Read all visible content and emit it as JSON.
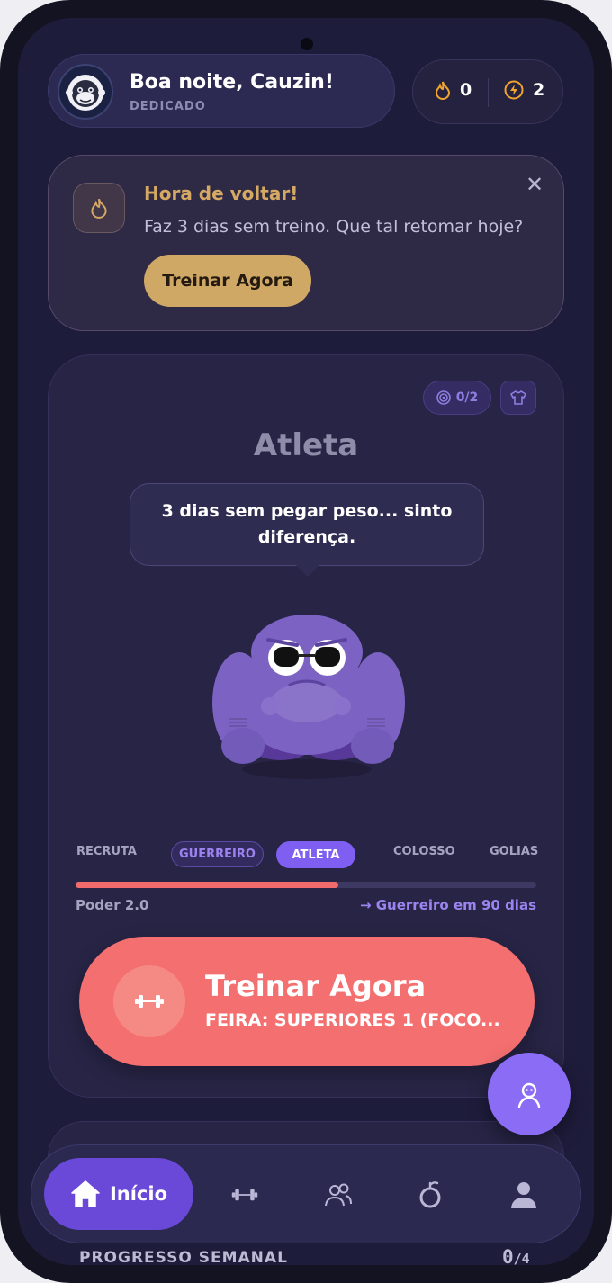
{
  "header": {
    "greeting": "Boa noite, Cauzin!",
    "rank": "DEDICADO",
    "streak_count": "0",
    "energy_count": "2"
  },
  "alert": {
    "title": "Hora de voltar!",
    "message": "Faz 3 dias sem treino. Que tal retomar hoje?",
    "button": "Treinar Agora",
    "close": "✕"
  },
  "character": {
    "goals": "0/2",
    "title": "Atleta",
    "speech": "3 dias sem pegar peso... sinto diferença.",
    "tiers": [
      "RECRUTA",
      "GUERREIRO",
      "ATLETA",
      "COLOSSO",
      "GOLIAS"
    ],
    "current_tier": "ATLETA",
    "progress_fraction": 0.57,
    "power": "Poder 2.0",
    "next_rank": "→ Guerreiro em 90 dias"
  },
  "train": {
    "title": "Treinar Agora",
    "subtitle": "FEIRA: SUPERIORES 1 (FOCO..."
  },
  "nav": {
    "home": "Início",
    "items": [
      "dumbbell-icon",
      "people-icon",
      "nutrition-icon",
      "profile-icon"
    ]
  },
  "weekly": {
    "label": "PROGRESSO SEMANAL",
    "done": "0",
    "total": "/4"
  },
  "colors": {
    "accent": "#7e5ff1",
    "train": "#f46f6f",
    "alert_gold": "#cfa866",
    "background": "#1e1c3b"
  }
}
